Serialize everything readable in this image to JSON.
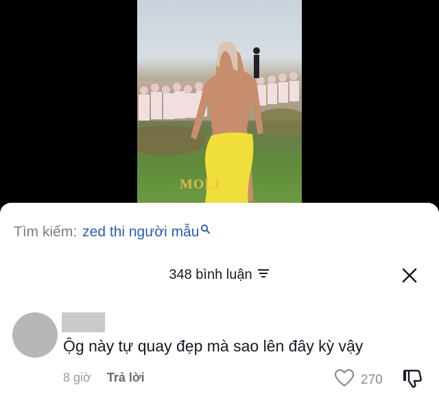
{
  "video": {
    "watermark": "MOLI"
  },
  "search": {
    "label": "Tìm kiếm:",
    "query": "zed thi người mẫu",
    "icon": "search-icon"
  },
  "comments_header": {
    "count_label": "348 bình luận",
    "filter_icon": "filter-icon",
    "close_icon": "close-icon"
  },
  "comment": {
    "text": "Ộg này tự quay đẹp mà sao lên đây kỳ vậy",
    "time": "8 giờ",
    "reply_label": "Trả lời",
    "likes": "270",
    "like_icon": "heart-icon",
    "dislike_icon": "thumbs-down-icon"
  },
  "colors": {
    "search_query": "#2b5db0",
    "text_primary": "#161823",
    "text_secondary": "#9a9b9f"
  }
}
